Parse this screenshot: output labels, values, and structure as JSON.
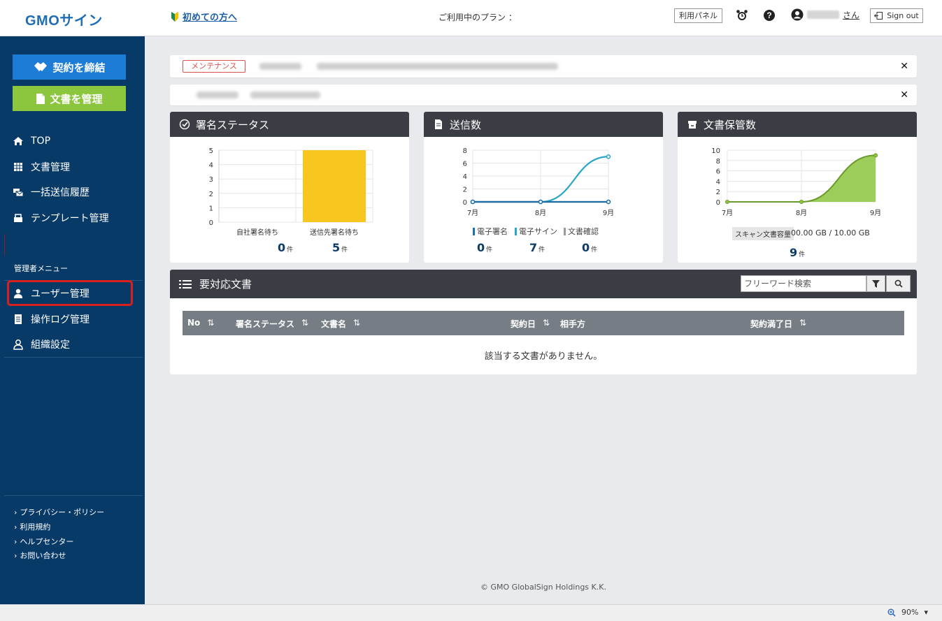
{
  "header": {
    "logo": "GMOサイン",
    "beginner_link": "初めての方へ",
    "plan_label": "ご利用中のプラン ：",
    "panel_button": "利用パネル",
    "user_suffix": "さん",
    "signout": "Sign out"
  },
  "sidebar": {
    "contract_button": "契約を締結",
    "docs_button": "文書を管理",
    "nav": [
      {
        "label": "TOP",
        "icon": "home-icon"
      },
      {
        "label": "文書管理",
        "icon": "table-icon"
      },
      {
        "label": "一括送信履歴",
        "icon": "bulk-send-icon"
      },
      {
        "label": "テンプレート管理",
        "icon": "template-icon"
      }
    ],
    "admin_label": "管理者メニュー",
    "admin_nav": [
      {
        "label": "ユーザー管理",
        "icon": "user-icon"
      },
      {
        "label": "操作ログ管理",
        "icon": "log-icon"
      },
      {
        "label": "組織設定",
        "icon": "org-icon"
      }
    ],
    "footer_links": [
      "プライバシー・ポリシー",
      "利用規約",
      "ヘルプセンター",
      "お問い合わせ"
    ]
  },
  "notices": {
    "maintenance_badge": "メンテナンス"
  },
  "cards": {
    "sign_status": {
      "title": "署名ステータス",
      "count1": "0",
      "count2": "5",
      "unit": "件"
    },
    "sent": {
      "title": "送信数",
      "legend": [
        "電子署名",
        "電子サイン",
        "文書確認"
      ],
      "counts": [
        "0",
        "7",
        "0"
      ],
      "unit": "件"
    },
    "storage": {
      "title": "文書保管数",
      "scan_label": "スキャン文書容量",
      "scan_value": "00.00 GB / 10.00 GB",
      "count": "9",
      "unit": "件"
    }
  },
  "chart_data": [
    {
      "type": "bar",
      "categories": [
        "自社署名待ち",
        "送信先署名待ち"
      ],
      "values": [
        0,
        5
      ],
      "ylim": [
        0,
        5
      ],
      "yticks": [
        "0",
        "1",
        "2",
        "3",
        "4",
        "5"
      ],
      "color": "#f7c61f"
    },
    {
      "type": "line",
      "categories": [
        "7月",
        "8月",
        "9月"
      ],
      "series": [
        {
          "name": "電子署名",
          "values": [
            0,
            0,
            0
          ],
          "color": "#1e6fa8"
        },
        {
          "name": "電子サイン",
          "values": [
            0,
            0,
            7
          ],
          "color": "#2aa6c8"
        },
        {
          "name": "文書確認",
          "values": [
            0,
            0,
            0
          ],
          "color": "#9a9a9a"
        }
      ],
      "ylim": [
        0,
        8
      ],
      "yticks": [
        "0",
        "2",
        "4",
        "6",
        "8"
      ]
    },
    {
      "type": "area",
      "categories": [
        "7月",
        "8月",
        "9月"
      ],
      "values": [
        0,
        0,
        9
      ],
      "ylim": [
        0,
        10
      ],
      "yticks": [
        "0",
        "2",
        "4",
        "6",
        "8",
        "10"
      ],
      "color": "#8cc63e"
    }
  ],
  "todo": {
    "title": "要対応文書",
    "search_placeholder": "フリーワード検索",
    "columns": [
      "No",
      "署名ステータス",
      "文書名",
      "契約日",
      "相手方",
      "契約満了日"
    ],
    "empty": "該当する文書がありません。"
  },
  "footer": {
    "copyright": "© GMO GlobalSign Holdings K.K."
  },
  "statusbar": {
    "zoom": "90%"
  }
}
